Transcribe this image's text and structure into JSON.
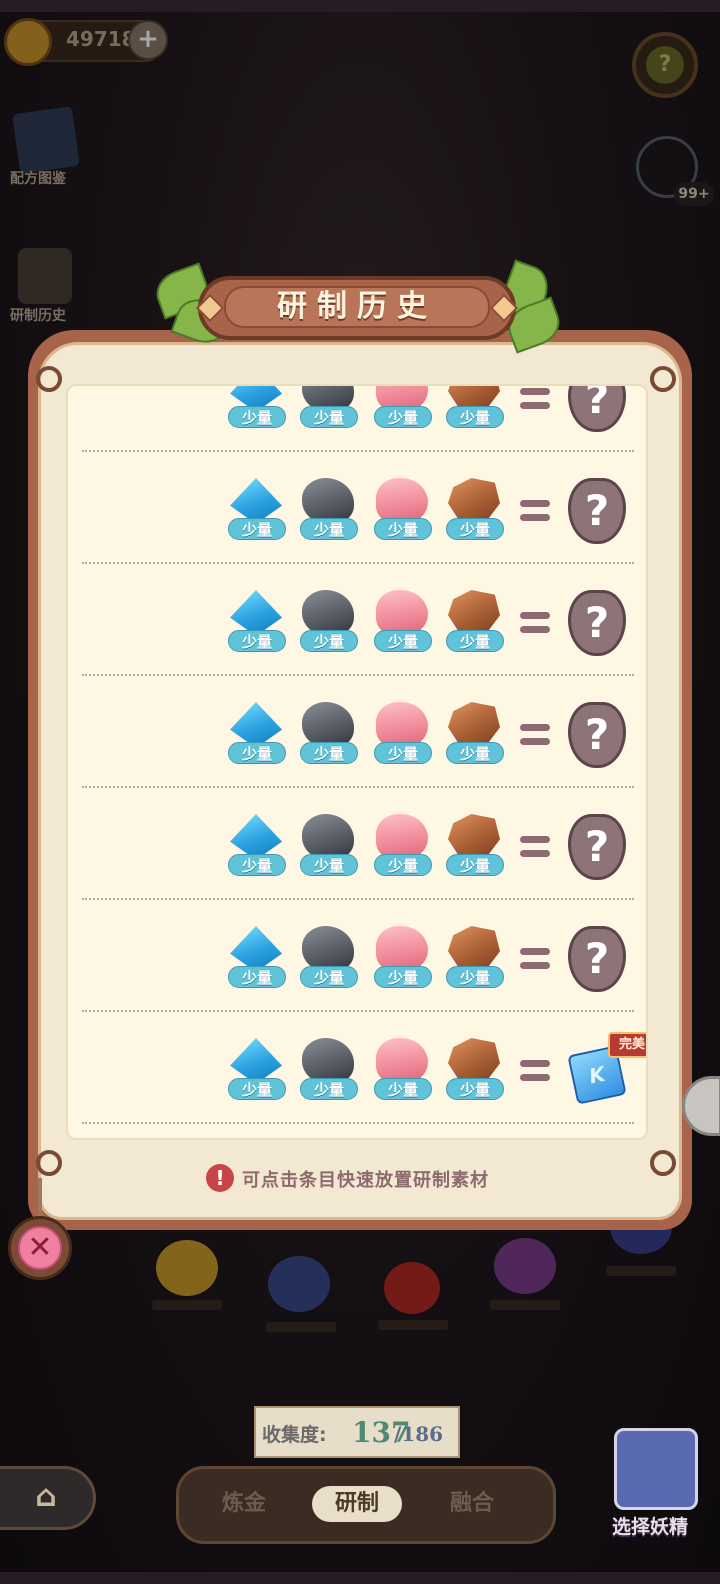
{
  "currency": {
    "amount": "49718",
    "plus": "+"
  },
  "side_buttons": {
    "recipe_book": "配方图鉴",
    "history": "研制历史"
  },
  "top_right": {
    "badge": "99+",
    "hint_symbol": "?"
  },
  "panel": {
    "title": "研制历史",
    "hint": "可点击条目快速放置研制素材",
    "hint_icon": "!",
    "quantity_label": "少量",
    "unknown_symbol": "?",
    "rows": [
      {
        "ingredients": [
          "crystal-icon",
          "rock-icon",
          "grub-icon",
          "ore-icon"
        ],
        "result": "unknown"
      },
      {
        "ingredients": [
          "crystal-icon",
          "rock-icon",
          "grub-icon",
          "ore-icon"
        ],
        "result": "unknown"
      },
      {
        "ingredients": [
          "crystal-icon",
          "rock-icon",
          "grub-icon",
          "ore-icon"
        ],
        "result": "unknown"
      },
      {
        "ingredients": [
          "crystal-icon",
          "rock-icon",
          "grub-icon",
          "ore-icon"
        ],
        "result": "unknown"
      },
      {
        "ingredients": [
          "crystal-icon",
          "rock-icon",
          "grub-icon",
          "ore-icon"
        ],
        "result": "unknown"
      },
      {
        "ingredients": [
          "crystal-icon",
          "rock-icon",
          "grub-icon",
          "ore-icon"
        ],
        "result": "unknown"
      },
      {
        "ingredients": [
          "crystal-icon",
          "rock-icon",
          "grub-icon",
          "ore-icon"
        ],
        "result": "blue-card",
        "result_letter": "K",
        "result_tag": "完美"
      }
    ]
  },
  "close_symbol": "✕",
  "collection": {
    "label": "收集度:",
    "value": "137",
    "total": "/186"
  },
  "nav": {
    "home_icon": "⌂",
    "tabs": [
      "炼金",
      "研制",
      "融合"
    ],
    "active_tab": "研制"
  },
  "fairy": {
    "label": "选择妖精"
  },
  "colors": {
    "panel_border": "#a8644a",
    "panel_bg": "#fdf7e4",
    "quantity_badge": "#62c3d8",
    "perfect_tag": "#b93a34"
  }
}
